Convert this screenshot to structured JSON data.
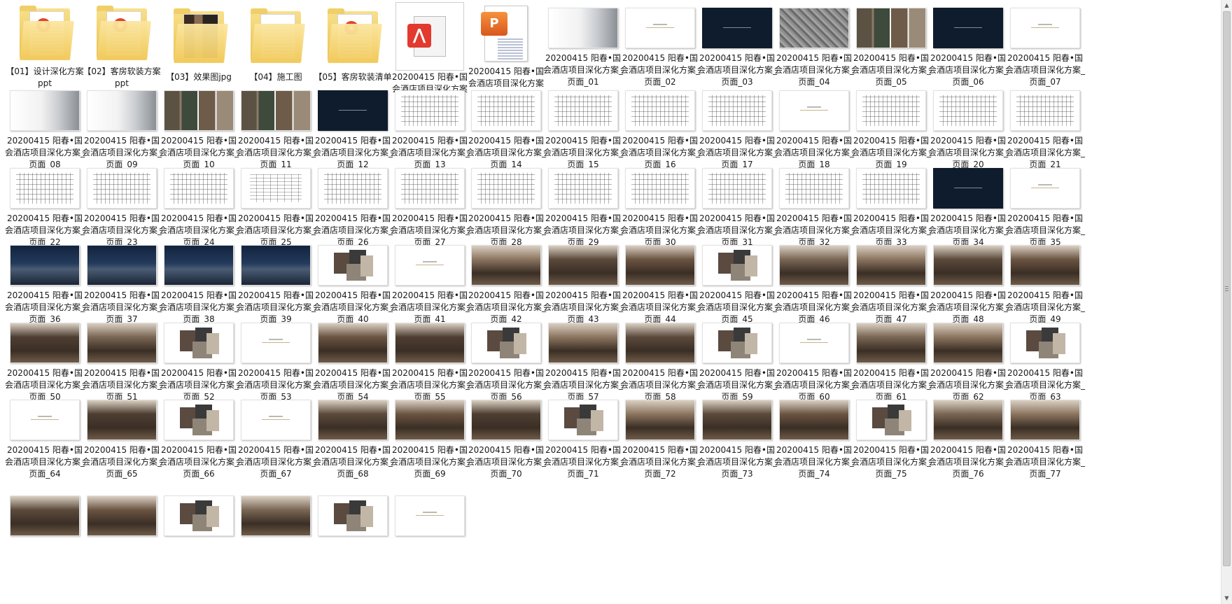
{
  "items": [
    {
      "kind": "folder",
      "label": "【01】设计深化方案ppt",
      "icon": "ppt-folder-icon",
      "badge": "#e0452c"
    },
    {
      "kind": "folder",
      "label": "【02】客房软装方案ppt",
      "icon": "ppt-folder-icon",
      "badge": "#e0452c"
    },
    {
      "kind": "folder",
      "label": "【03】效果图jpg",
      "icon": "image-folder-icon",
      "badge": ""
    },
    {
      "kind": "folder",
      "label": "【04】施工图",
      "icon": "document-folder-icon",
      "badge": ""
    },
    {
      "kind": "folder",
      "label": "【05】客房软装清单",
      "icon": "pdf-folder-icon",
      "badge": "#e0452c"
    },
    {
      "kind": "pdf",
      "label": "20200415 阳春•国会酒店项目深化方案",
      "icon": "pdf-file-icon"
    },
    {
      "kind": "ppt",
      "label": "20200415 阳春•国会酒店项目深化方案",
      "icon": "ppt-file-icon"
    },
    {
      "kind": "page",
      "label": "20200415 阳春•国会酒店项目深化方案_页面_01",
      "style": "mist"
    },
    {
      "kind": "page",
      "label": "20200415 阳春•国会酒店项目深化方案_页面_02",
      "style": "text"
    },
    {
      "kind": "page",
      "label": "20200415 阳春•国会酒店项目深化方案_页面_03",
      "style": "dark"
    },
    {
      "kind": "page",
      "label": "20200415 阳春•国会酒店项目深化方案_页面_04",
      "style": "map"
    },
    {
      "kind": "page",
      "label": "20200415 阳春•国会酒店项目深化方案_页面_05",
      "style": "collage"
    },
    {
      "kind": "page",
      "label": "20200415 阳春•国会酒店项目深化方案_页面_06",
      "style": "dark"
    },
    {
      "kind": "page",
      "label": "20200415 阳春•国会酒店项目深化方案_页面_07",
      "style": "text"
    },
    {
      "kind": "page",
      "label": "20200415 阳春•国会酒店项目深化方案_页面_08",
      "style": "mist"
    },
    {
      "kind": "page",
      "label": "20200415 阳春•国会酒店项目深化方案_页面_09",
      "style": "mist"
    },
    {
      "kind": "page",
      "label": "20200415 阳春•国会酒店项目深化方案_页面_10",
      "style": "collage"
    },
    {
      "kind": "page",
      "label": "20200415 阳春•国会酒店项目深化方案_页面_11",
      "style": "collage"
    },
    {
      "kind": "page",
      "label": "20200415 阳春•国会酒店项目深化方案_页面_12",
      "style": "dark"
    },
    {
      "kind": "page",
      "label": "20200415 阳春•国会酒店项目深化方案_页面_13",
      "style": "plan"
    },
    {
      "kind": "page",
      "label": "20200415 阳春•国会酒店项目深化方案_页面_14",
      "style": "plan"
    },
    {
      "kind": "page",
      "label": "20200415 阳春•国会酒店项目深化方案_页面_15",
      "style": "plan"
    },
    {
      "kind": "page",
      "label": "20200415 阳春•国会酒店项目深化方案_页面_16",
      "style": "plan"
    },
    {
      "kind": "page",
      "label": "20200415 阳春•国会酒店项目深化方案_页面_17",
      "style": "plan"
    },
    {
      "kind": "page",
      "label": "20200415 阳春•国会酒店项目深化方案_页面_18",
      "style": "text"
    },
    {
      "kind": "page",
      "label": "20200415 阳春•国会酒店项目深化方案_页面_19",
      "style": "plan"
    },
    {
      "kind": "page",
      "label": "20200415 阳春•国会酒店项目深化方案_页面_20",
      "style": "plan"
    },
    {
      "kind": "page",
      "label": "20200415 阳春•国会酒店项目深化方案_页面_21",
      "style": "plan"
    },
    {
      "kind": "page",
      "label": "20200415 阳春•国会酒店项目深化方案_页面_22",
      "style": "plan"
    },
    {
      "kind": "page",
      "label": "20200415 阳春•国会酒店项目深化方案_页面_23",
      "style": "plan"
    },
    {
      "kind": "page",
      "label": "20200415 阳春•国会酒店项目深化方案_页面_24",
      "style": "plan"
    },
    {
      "kind": "page",
      "label": "20200415 阳春•国会酒店项目深化方案_页面_25",
      "style": "grid"
    },
    {
      "kind": "page",
      "label": "20200415 阳春•国会酒店项目深化方案_页面_26",
      "style": "plan"
    },
    {
      "kind": "page",
      "label": "20200415 阳春•国会酒店项目深化方案_页面_27",
      "style": "plan"
    },
    {
      "kind": "page",
      "label": "20200415 阳春•国会酒店项目深化方案_页面_28",
      "style": "plan"
    },
    {
      "kind": "page",
      "label": "20200415 阳春•国会酒店项目深化方案_页面_29",
      "style": "plan"
    },
    {
      "kind": "page",
      "label": "20200415 阳春•国会酒店项目深化方案_页面_30",
      "style": "plan"
    },
    {
      "kind": "page",
      "label": "20200415 阳春•国会酒店项目深化方案_页面_31",
      "style": "plan"
    },
    {
      "kind": "page",
      "label": "20200415 阳春•国会酒店项目深化方案_页面_32",
      "style": "plan"
    },
    {
      "kind": "page",
      "label": "20200415 阳春•国会酒店项目深化方案_页面_33",
      "style": "plan"
    },
    {
      "kind": "page",
      "label": "20200415 阳春•国会酒店项目深化方案_页面_34",
      "style": "dark"
    },
    {
      "kind": "page",
      "label": "20200415 阳春•国会酒店项目深化方案_页面_35",
      "style": "text"
    },
    {
      "kind": "page",
      "label": "20200415 阳春•国会酒店项目深化方案_页面_36",
      "style": "night"
    },
    {
      "kind": "page",
      "label": "20200415 阳春•国会酒店项目深化方案_页面_37",
      "style": "night"
    },
    {
      "kind": "page",
      "label": "20200415 阳春•国会酒店项目深化方案_页面_38",
      "style": "night"
    },
    {
      "kind": "page",
      "label": "20200415 阳春•国会酒店项目深化方案_页面_39",
      "style": "night"
    },
    {
      "kind": "page",
      "label": "20200415 阳春•国会酒店项目深化方案_页面_40",
      "style": "material"
    },
    {
      "kind": "page",
      "label": "20200415 阳春•国会酒店项目深化方案_页面_41",
      "style": "text"
    },
    {
      "kind": "page",
      "label": "20200415 阳春•国会酒店项目深化方案_页面_42",
      "style": "interior"
    },
    {
      "kind": "page",
      "label": "20200415 阳春•国会酒店项目深化方案_页面_43",
      "style": "interior"
    },
    {
      "kind": "page",
      "label": "20200415 阳春•国会酒店项目深化方案_页面_44",
      "style": "interior"
    },
    {
      "kind": "page",
      "label": "20200415 阳春•国会酒店项目深化方案_页面_45",
      "style": "material"
    },
    {
      "kind": "page",
      "label": "20200415 阳春•国会酒店项目深化方案_页面_46",
      "style": "interior"
    },
    {
      "kind": "page",
      "label": "20200415 阳春•国会酒店项目深化方案_页面_47",
      "style": "interior"
    },
    {
      "kind": "page",
      "label": "20200415 阳春•国会酒店项目深化方案_页面_48",
      "style": "interior"
    },
    {
      "kind": "page",
      "label": "20200415 阳春•国会酒店项目深化方案_页面_49",
      "style": "interior"
    },
    {
      "kind": "page",
      "label": "20200415 阳春•国会酒店项目深化方案_页面_50",
      "style": "interior"
    },
    {
      "kind": "page",
      "label": "20200415 阳春•国会酒店项目深化方案_页面_51",
      "style": "interior"
    },
    {
      "kind": "page",
      "label": "20200415 阳春•国会酒店项目深化方案_页面_52",
      "style": "material"
    },
    {
      "kind": "page",
      "label": "20200415 阳春•国会酒店项目深化方案_页面_53",
      "style": "text"
    },
    {
      "kind": "page",
      "label": "20200415 阳春•国会酒店项目深化方案_页面_54",
      "style": "interior"
    },
    {
      "kind": "page",
      "label": "20200415 阳春•国会酒店项目深化方案_页面_55",
      "style": "interior"
    },
    {
      "kind": "page",
      "label": "20200415 阳春•国会酒店项目深化方案_页面_56",
      "style": "material"
    },
    {
      "kind": "page",
      "label": "20200415 阳春•国会酒店项目深化方案_页面_57",
      "style": "interior"
    },
    {
      "kind": "page",
      "label": "20200415 阳春•国会酒店项目深化方案_页面_58",
      "style": "interior"
    },
    {
      "kind": "page",
      "label": "20200415 阳春•国会酒店项目深化方案_页面_59",
      "style": "material"
    },
    {
      "kind": "page",
      "label": "20200415 阳春•国会酒店项目深化方案_页面_60",
      "style": "text"
    },
    {
      "kind": "page",
      "label": "20200415 阳春•国会酒店项目深化方案_页面_61",
      "style": "interior"
    },
    {
      "kind": "page",
      "label": "20200415 阳春•国会酒店项目深化方案_页面_62",
      "style": "interior"
    },
    {
      "kind": "page",
      "label": "20200415 阳春•国会酒店项目深化方案_页面_63",
      "style": "material"
    },
    {
      "kind": "page",
      "label": "20200415 阳春•国会酒店项目深化方案_页面_64",
      "style": "text"
    },
    {
      "kind": "page",
      "label": "20200415 阳春•国会酒店项目深化方案_页面_65",
      "style": "interior"
    },
    {
      "kind": "page",
      "label": "20200415 阳春•国会酒店项目深化方案_页面_66",
      "style": "material"
    },
    {
      "kind": "page",
      "label": "20200415 阳春•国会酒店项目深化方案_页面_67",
      "style": "text"
    },
    {
      "kind": "page",
      "label": "20200415 阳春•国会酒店项目深化方案_页面_68",
      "style": "interior"
    },
    {
      "kind": "page",
      "label": "20200415 阳春•国会酒店项目深化方案_页面_69",
      "style": "interior"
    },
    {
      "kind": "page",
      "label": "20200415 阳春•国会酒店项目深化方案_页面_70",
      "style": "interior"
    },
    {
      "kind": "page",
      "label": "20200415 阳春•国会酒店项目深化方案_页面_71",
      "style": "material"
    },
    {
      "kind": "page",
      "label": "20200415 阳春•国会酒店项目深化方案_页面_72",
      "style": "interior"
    },
    {
      "kind": "page",
      "label": "20200415 阳春•国会酒店项目深化方案_页面_73",
      "style": "interior"
    },
    {
      "kind": "page",
      "label": "20200415 阳春•国会酒店项目深化方案_页面_74",
      "style": "interior"
    },
    {
      "kind": "page",
      "label": "20200415 阳春•国会酒店项目深化方案_页面_75",
      "style": "material"
    },
    {
      "kind": "page",
      "label": "20200415 阳春•国会酒店项目深化方案_页面_76",
      "style": "interior"
    },
    {
      "kind": "page",
      "label": "20200415 阳春•国会酒店项目深化方案_页面_77",
      "style": "interior"
    },
    {
      "kind": "page",
      "label": "",
      "style": "interior"
    },
    {
      "kind": "page",
      "label": "",
      "style": "interior"
    },
    {
      "kind": "page",
      "label": "",
      "style": "material"
    },
    {
      "kind": "page",
      "label": "",
      "style": "interior"
    },
    {
      "kind": "page",
      "label": "",
      "style": "material"
    },
    {
      "kind": "page",
      "label": "",
      "style": "text"
    }
  ],
  "style_colors": {
    "dark": "#0f1c2e",
    "night": "#1f3250",
    "interior": "#5a4636",
    "accent_pdf": "#e23a2e",
    "accent_ppt": "#e8732e"
  }
}
